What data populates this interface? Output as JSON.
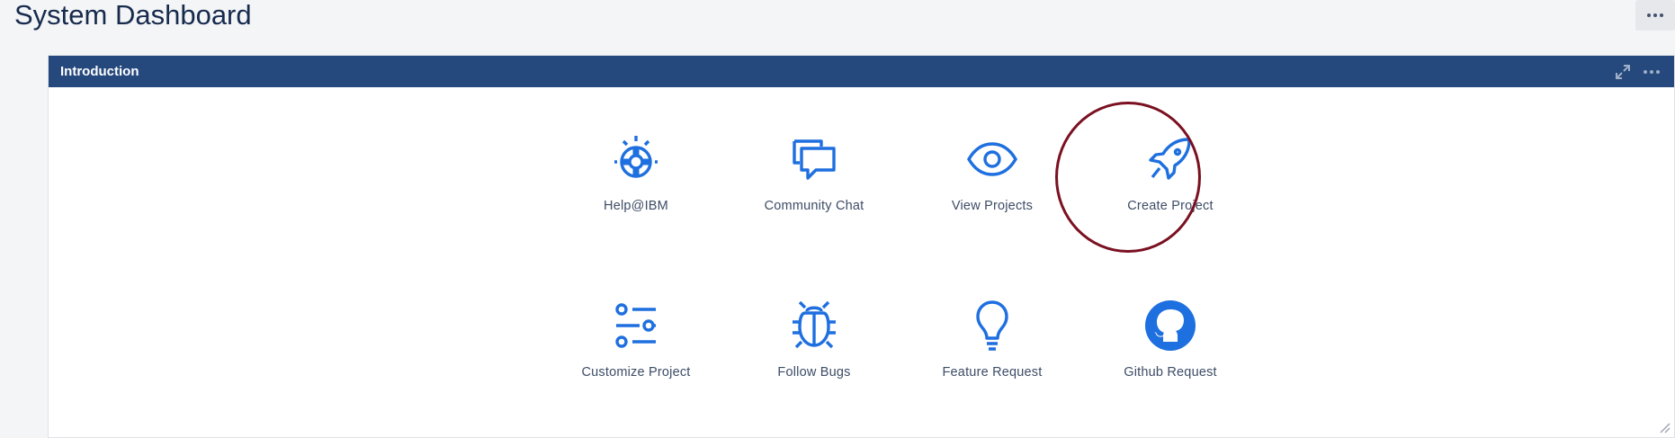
{
  "page": {
    "title": "System Dashboard"
  },
  "gadget": {
    "title": "Introduction"
  },
  "tiles": [
    {
      "label": "Help@IBM",
      "icon": "lifebuoy-icon"
    },
    {
      "label": "Community Chat",
      "icon": "chat-bubbles-icon"
    },
    {
      "label": "View Projects",
      "icon": "eye-icon"
    },
    {
      "label": "Create Project",
      "icon": "rocket-icon"
    },
    {
      "label": "Customize Project",
      "icon": "settings-sliders-icon"
    },
    {
      "label": "Follow Bugs",
      "icon": "bug-icon"
    },
    {
      "label": "Feature Request",
      "icon": "lightbulb-icon"
    },
    {
      "label": "Github Request",
      "icon": "github-icon"
    }
  ],
  "colors": {
    "header": "#25487d",
    "icon": "#1e6fdf",
    "highlight": "#7a1020"
  }
}
